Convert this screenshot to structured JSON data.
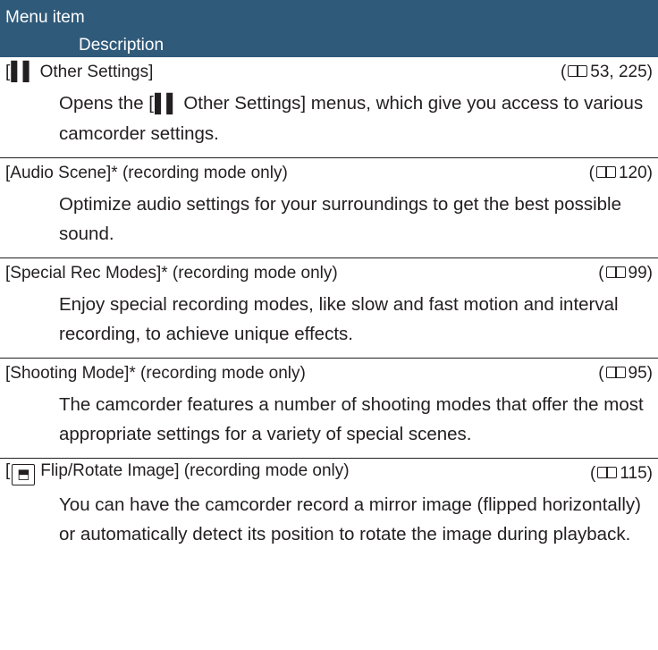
{
  "header": {
    "col1": "Menu item",
    "col2": "Description"
  },
  "icons": {
    "tools": "tools-icon",
    "flip": "flip-rotate-icon",
    "book": "book-reference-icon"
  },
  "entries": [
    {
      "title": "Other Settings]",
      "glyph_text": "▌▌",
      "ref": "53, 225",
      "description_parts": [
        "Opens the [",
        "Other Settings] menus, which give you access to various camcorder settings."
      ]
    },
    {
      "title": "[Audio Scene]* (recording mode only)",
      "ref": "120",
      "description": "Optimize audio settings for your surroundings to get the best possible sound."
    },
    {
      "title": "[Special Rec Modes]* (recording mode only)",
      "ref": "99",
      "description": "Enjoy special recording modes, like slow and fast motion and interval recording, to achieve unique effects."
    },
    {
      "title": "[Shooting Mode]* (recording mode only)",
      "ref": "95",
      "description": "The camcorder features a number of shooting modes that offer the most appropriate settings for a variety of special scenes."
    },
    {
      "title": "Flip/Rotate Image] (recording mode only)",
      "ref": "115",
      "description": "You can have the camcorder record a mirror image (flipped horizontally) or automatically detect its position to rotate the image during playback."
    }
  ]
}
